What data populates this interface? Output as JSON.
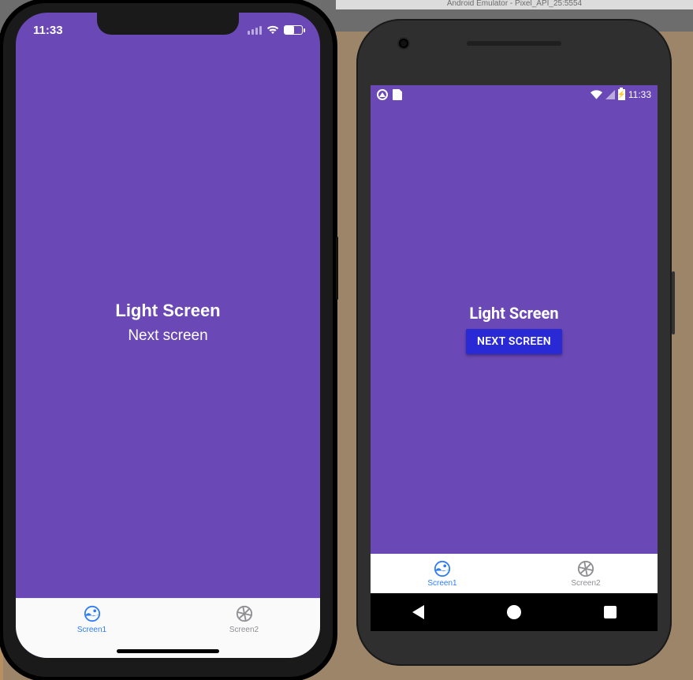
{
  "emulator_title": "Android Emulator - Pixel_API_25:5554",
  "ios": {
    "status_time": "11:33",
    "content_title": "Light Screen",
    "next_label": "Next screen",
    "tabs": [
      {
        "label": "Screen1",
        "active": true
      },
      {
        "label": "Screen2",
        "active": false
      }
    ]
  },
  "android": {
    "status_time": "11:33",
    "content_title": "Light Screen",
    "next_button": "NEXT SCREEN",
    "tabs": [
      {
        "label": "Screen1",
        "active": true
      },
      {
        "label": "Screen2",
        "active": false
      }
    ]
  },
  "colors": {
    "screen_fill": "#6A48B5",
    "ios_active_tab": "#2F7CF6",
    "android_button": "#2A29D6",
    "inactive_tab": "#8E8E93"
  }
}
